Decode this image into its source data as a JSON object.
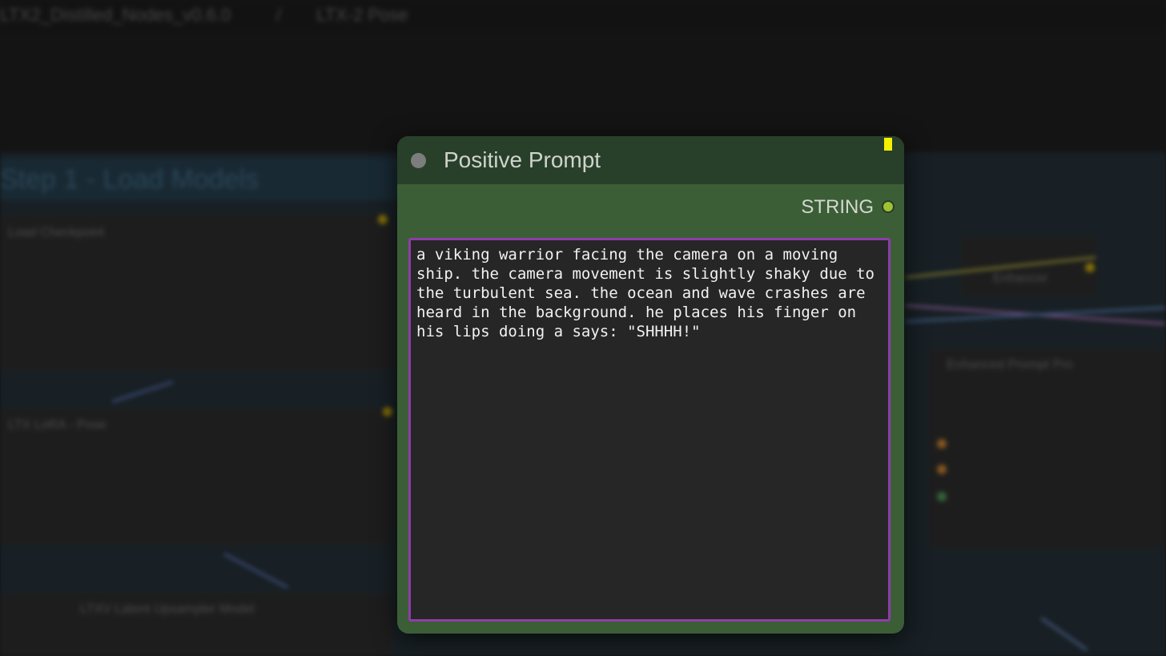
{
  "background": {
    "breadcrumb_left": "LTX2_Distilled_Nodes_v0.6.0",
    "breadcrumb_separator": "/",
    "breadcrumb_right": "LTX-2 Pose",
    "group_title": "Step 1 - Load Models",
    "nodes": {
      "load_checkpoint": "Load Checkpoint",
      "lora": "LTX LoRA - Pose",
      "upsampler": "LTXV Latent Upsampler Model",
      "enhancer": "Enhancer",
      "prompt_enhancer": "Enhanced Prompt Pro"
    }
  },
  "node": {
    "title": "Positive Prompt",
    "output_label": "STRING",
    "prompt_text": "a viking warrior facing the camera on a moving ship. the camera movement is slightly shaky due to the turbulent sea. the ocean and wave crashes are heard in the background. he places his finger on his lips doing a says: \"SHHHH!\""
  },
  "colors": {
    "node_body": "#3b5e37",
    "node_header": "#28402a",
    "socket_string": "#9ec234",
    "textbox_border": "#8e3da8",
    "marker": "#f4f000"
  }
}
